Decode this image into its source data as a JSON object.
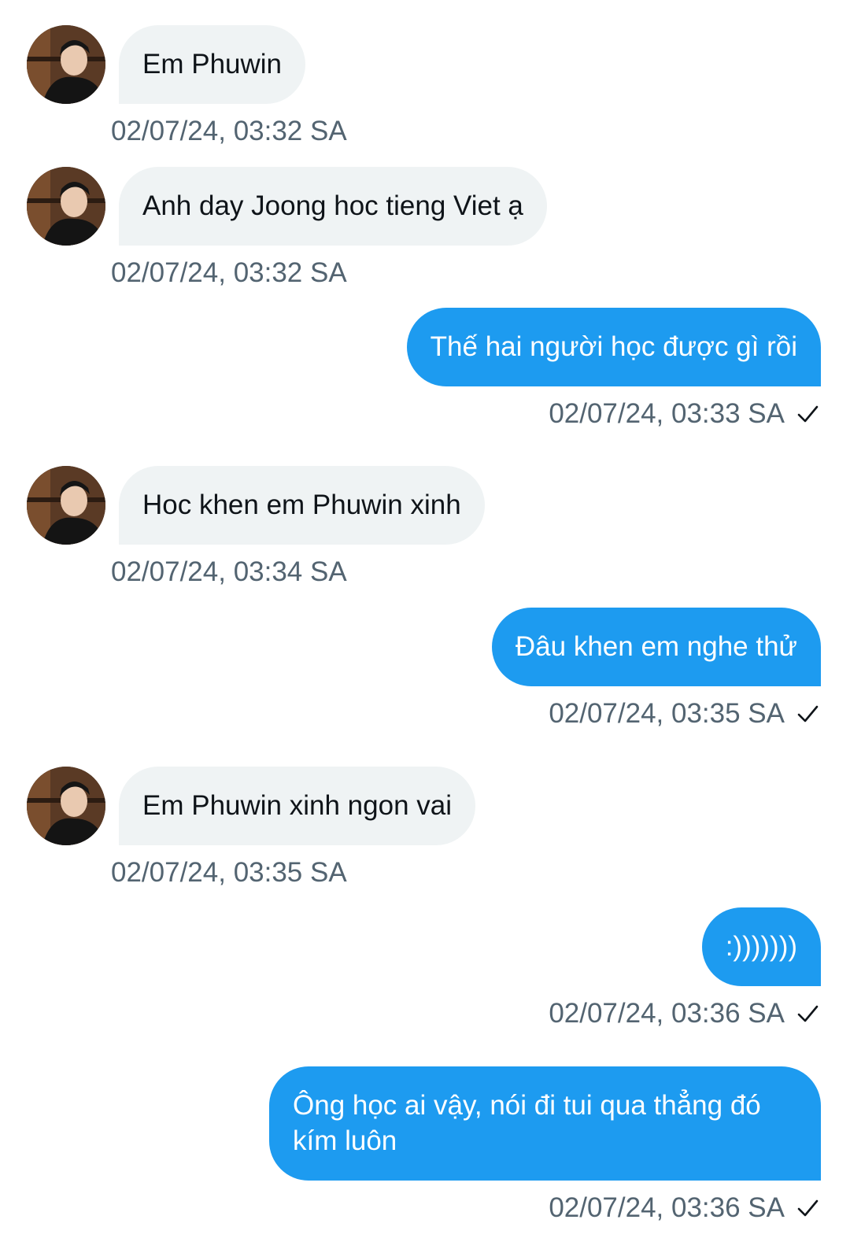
{
  "messages": [
    {
      "direction": "in",
      "text": "Em Phuwin",
      "time": "02/07/24, 03:32 SA"
    },
    {
      "direction": "in",
      "text": "Anh day Joong hoc tieng Viet ạ",
      "time": "02/07/24, 03:32 SA"
    },
    {
      "direction": "out",
      "text": "Thế hai người học được gì rồi",
      "time": "02/07/24, 03:33 SA"
    },
    {
      "direction": "in",
      "text": "Hoc khen em Phuwin xinh",
      "time": "02/07/24, 03:34 SA"
    },
    {
      "direction": "out",
      "text": "Đâu khen em nghe thử",
      "time": "02/07/24, 03:35 SA"
    },
    {
      "direction": "in",
      "text": "Em Phuwin xinh ngon vai",
      "time": "02/07/24, 03:35 SA"
    },
    {
      "direction": "out",
      "text": ":)))))))",
      "time": "02/07/24, 03:36 SA"
    },
    {
      "direction": "out",
      "text": "Ông học ai vậy, nói đi tui qua thẳng đó kím luôn",
      "time": "02/07/24, 03:36 SA"
    }
  ],
  "icons": {
    "avatar": "profile-photo",
    "sent_status": "checkmark-icon"
  },
  "colors": {
    "incoming_bubble": "#eff3f4",
    "outgoing_bubble": "#1d9bf0",
    "timestamp": "#536471"
  }
}
